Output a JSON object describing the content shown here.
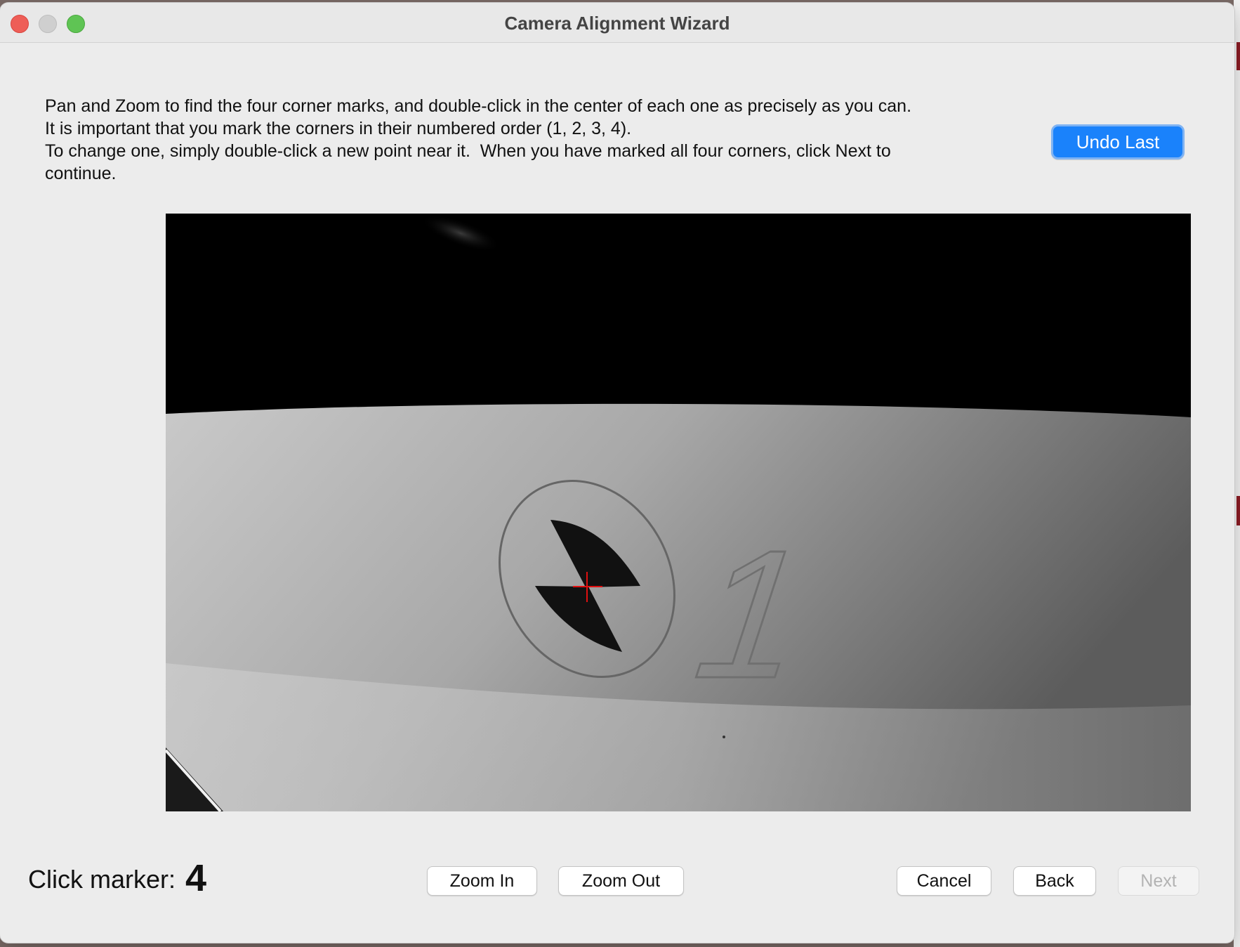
{
  "window": {
    "title": "Camera Alignment Wizard"
  },
  "instructions": [
    "Pan and Zoom to find the four corner marks, and double-click in the center of each one as precisely as you can.",
    "It is important that you mark the corners in their numbered order (1, 2, 3, 4).",
    "To change one, simply double-click a new point near it.  When you have marked all four corners, click Next to",
    "continue."
  ],
  "buttons": {
    "undo_last": "Undo Last",
    "zoom_in": "Zoom In",
    "zoom_out": "Zoom Out",
    "cancel": "Cancel",
    "back": "Back",
    "next": "Next"
  },
  "status": {
    "click_marker_label": "Click marker:",
    "click_marker_value": "4"
  },
  "camera_view": {
    "marker_number": "1"
  },
  "colors": {
    "primary_button": "#1a82fb",
    "crosshair": "#e01010"
  }
}
